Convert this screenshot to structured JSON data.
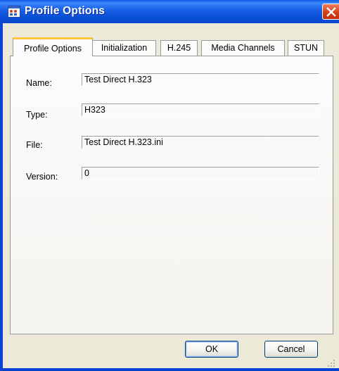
{
  "window": {
    "title": "Profile Options"
  },
  "tabs": [
    {
      "label": "Profile Options"
    },
    {
      "label": "Initialization"
    },
    {
      "label": "H.245"
    },
    {
      "label": "Media Channels"
    },
    {
      "label": "STUN"
    }
  ],
  "fields": {
    "name": {
      "label": "Name:",
      "value": "Test Direct H.323"
    },
    "type": {
      "label": "Type:",
      "value": "H323"
    },
    "file": {
      "label": "File:",
      "value": "Test Direct H.323.ini"
    },
    "version": {
      "label": "Version:",
      "value": "0"
    }
  },
  "buttons": {
    "ok": "OK",
    "cancel": "Cancel"
  },
  "colors": {
    "titlebar": "#0a4fd8",
    "close": "#d64018",
    "dialog": "#ece9d8",
    "active_tab_accent": "#ffc83c"
  }
}
